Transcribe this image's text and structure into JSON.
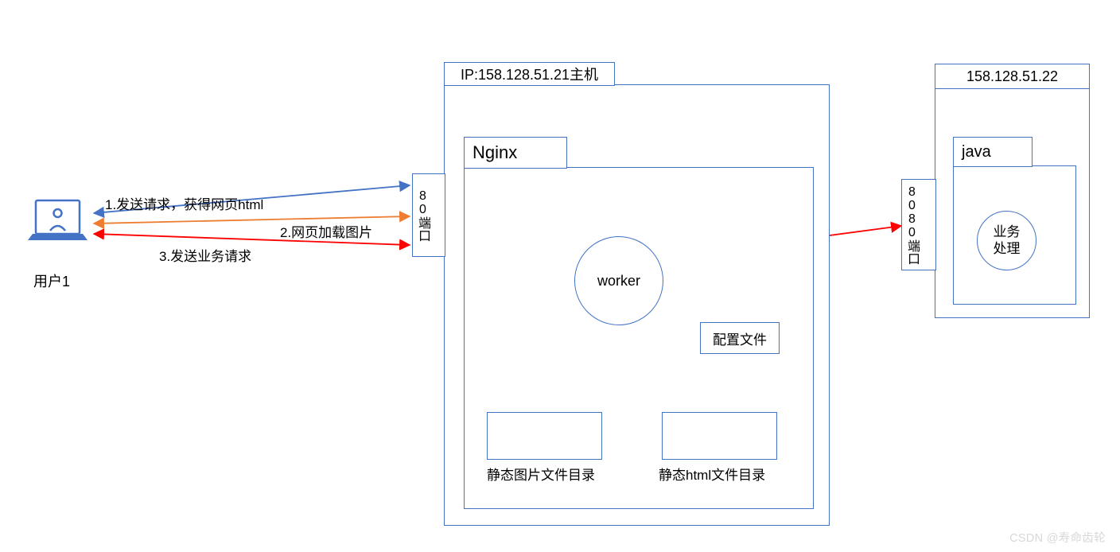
{
  "user": {
    "label": "用户1"
  },
  "flows": {
    "f1": "1.发送请求，获得网页html",
    "f2": "2.网页加载图片",
    "f3": "3.发送业务请求"
  },
  "host1": {
    "title": "IP:158.128.51.21主机",
    "port80": "80端口",
    "nginx": {
      "title": "Nginx",
      "worker": "worker",
      "config": "配置文件",
      "staticImg": "静态图片文件目录",
      "staticHtml": "静态html文件目录"
    }
  },
  "host2": {
    "title": "158.128.51.22",
    "port8080": "8080端口",
    "java": {
      "title": "java",
      "biz": "业务\n处理"
    }
  },
  "watermark": "CSDN @寿命齿轮",
  "colors": {
    "blue": "#4472C4",
    "orange": "#ED7D31",
    "red": "#FF0000"
  }
}
